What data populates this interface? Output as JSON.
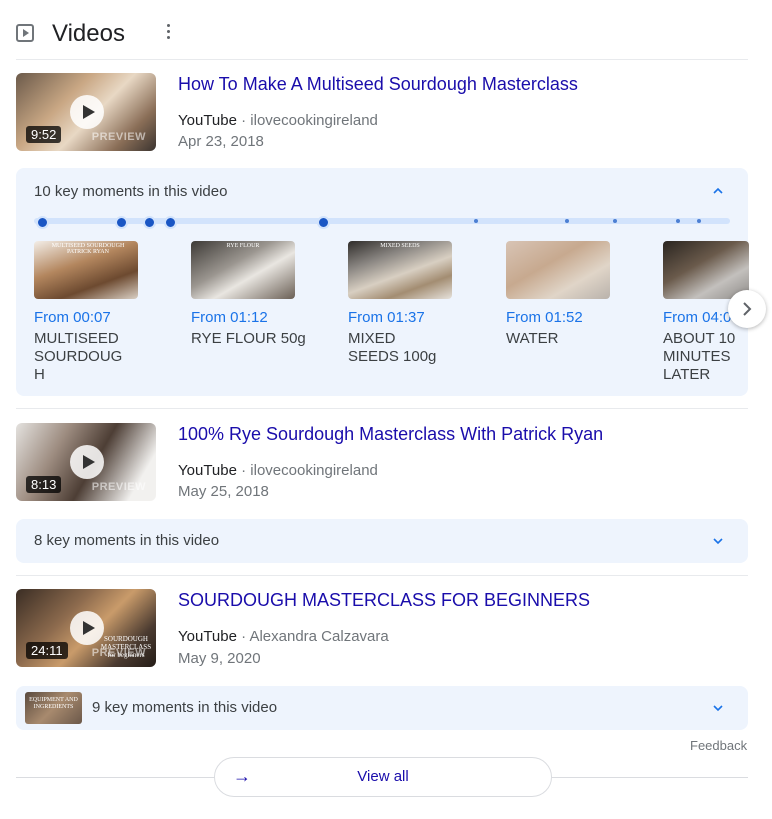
{
  "header": {
    "title": "Videos",
    "video_icon": "video-play-icon",
    "menu_icon": "more-vert-icon"
  },
  "videos": [
    {
      "title": "How To Make A Multiseed Sourdough Masterclass",
      "source": "YouTube",
      "channel": "ilovecookingireland",
      "date": "Apr 23, 2018",
      "duration": "9:52",
      "preview": "PREVIEW",
      "key_moments_label": "10 key moments in this video",
      "expanded": true,
      "moments": [
        {
          "from": "From 00:07",
          "label": "MULTISEED SOURDOUG H"
        },
        {
          "from": "From 01:12",
          "label": "RYE FLOUR 50g"
        },
        {
          "from": "From 01:37",
          "label": "MIXED SEEDS 100g"
        },
        {
          "from": "From 01:52",
          "label": "WATER"
        },
        {
          "from": "From 04:0",
          "label": "ABOUT 10 MINUTES LATER"
        }
      ],
      "moment_thumb_captions": [
        "MULTISEED SOURDOUGH PATRICK RYAN",
        "RYE FLOUR",
        "MIXED SEEDS",
        "",
        ""
      ]
    },
    {
      "title": "100% Rye Sourdough Masterclass With Patrick Ryan",
      "source": "YouTube",
      "channel": "ilovecookingireland",
      "date": "May 25, 2018",
      "duration": "8:13",
      "preview": "PREVIEW",
      "key_moments_label": "8 key moments in this video",
      "expanded": false
    },
    {
      "title": "SOURDOUGH MASTERCLASS FOR BEGINNERS",
      "source": "YouTube",
      "channel": "Alexandra Calzavara",
      "date": "May 9, 2020",
      "duration": "24:11",
      "preview": "PREVIEW",
      "thumb_caption": "SOURDOUGH MASTERCLASS for beginners",
      "key_moments_label": "9 key moments in this video",
      "key_moments_thumb_caption": "EQUIPMENT AND INGREDIENTS",
      "expanded": false
    }
  ],
  "separator": "·",
  "feedback": "Feedback",
  "view_all": "View all",
  "colors": {
    "link": "#1a0dab",
    "moment_time": "#1a73e8",
    "panel": "#eef4fd",
    "timeline_dot": "#1a56c4"
  }
}
